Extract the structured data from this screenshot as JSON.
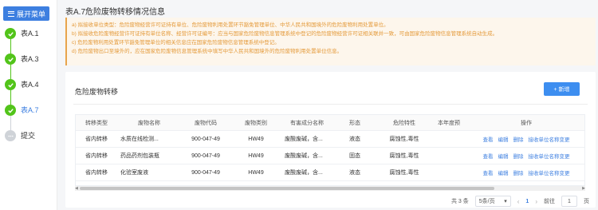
{
  "sidebar": {
    "menu_label": "展开菜单",
    "steps": [
      {
        "label": "表A.1",
        "status": "done"
      },
      {
        "label": "表A.3",
        "status": "done"
      },
      {
        "label": "表A.4",
        "status": "done"
      },
      {
        "label": "表A.7",
        "status": "active"
      },
      {
        "label": "提交",
        "status": "pending"
      }
    ]
  },
  "page": {
    "title": "表A.7危险废物转移情况信息"
  },
  "notice": [
    "a) 拟接收单位类型：危险废物经营许可证持有单位、危险废物利用处置环节豁免管理单位、中华人民共和国境外的危险废物利用处置单位。",
    "b) 拟接收危险废物经营许可证持有单位名称、经营许可证编号：应当与国家危险废物信息管理系统中登记的危险废物经营许可证相关联并一致，可由国家危险废物信息管理系统自动生成。",
    "c) 危险废物利用处置环节豁免管理单位的相关信息应在国家危险废物信息管理系统中登记。",
    "d) 危险废物出口至境外的，应在国家危险废物信息管理系统中填写中华人民共和国境外的危险废物利用处置单位信息。"
  ],
  "panel": {
    "title": "危险废物转移",
    "add_label": "+ 新增"
  },
  "table": {
    "columns": [
      "转移类型",
      "废物名称",
      "废物代码",
      "废物类别",
      "有害成分名称",
      "形态",
      "危险特性",
      "本年度预",
      "操作"
    ],
    "rows": [
      {
        "type": "省内转移",
        "name": "水质在线检测...",
        "code": "900-047-49",
        "category": "HW49",
        "harmful": "废酸废碱，含...",
        "form": "液态",
        "hazard": "腐蚀性,毒性",
        "estimate": ""
      },
      {
        "type": "省内转移",
        "name": "药品药剂包装瓶",
        "code": "900-047-49",
        "category": "HW49",
        "harmful": "废酸废碱，含...",
        "form": "固态",
        "hazard": "腐蚀性,毒性",
        "estimate": ""
      },
      {
        "type": "省内转移",
        "name": "化验室废液",
        "code": "900-047-49",
        "category": "HW49",
        "harmful": "废酸废碱，含...",
        "form": "液态",
        "hazard": "腐蚀性,毒性",
        "estimate": ""
      }
    ],
    "actions": [
      "查看",
      "编辑",
      "删除",
      "接收单位名称变更"
    ]
  },
  "pagination": {
    "total": "共 3 条",
    "page_size": "5条/页",
    "current_page": "1",
    "goto_label": "前往",
    "goto_value": "1",
    "page_unit": "页"
  }
}
